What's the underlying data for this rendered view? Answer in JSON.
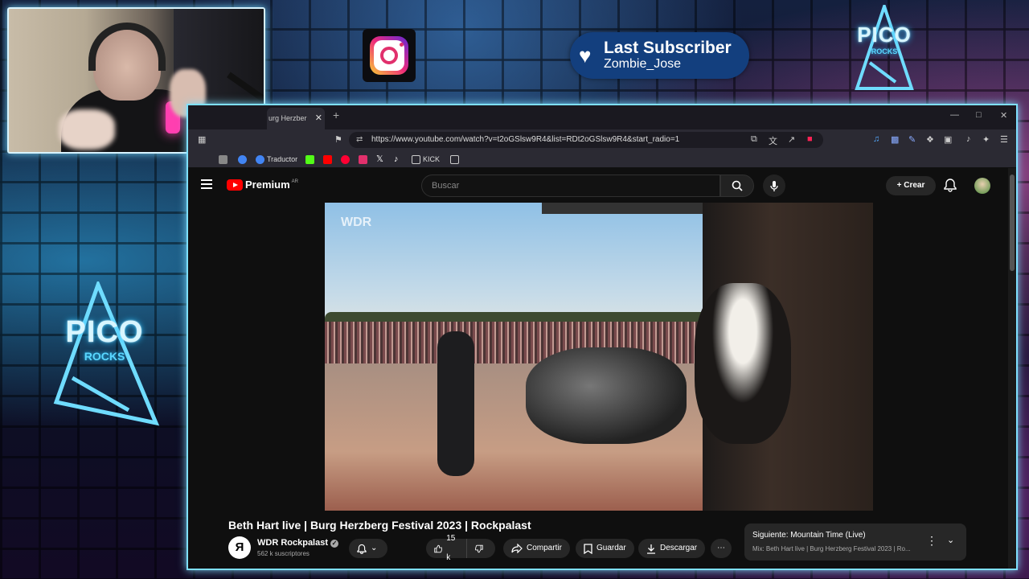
{
  "overlay": {
    "last_subscriber_title": "Last Subscriber",
    "last_subscriber_name": "Zombie_Jose",
    "logo_top_word": "PICO",
    "logo_top_sub": "ROCKS",
    "logo_side_word": "PICO",
    "logo_side_sub": "ROCKS",
    "accent_color": "#7fe0ff",
    "badge_color": "#133f7e",
    "icons": [
      "instagram-icon",
      "heart-icon"
    ]
  },
  "browser": {
    "tab_title": "urg Herzber",
    "url": "https://www.youtube.com/watch?v=t2oGSlsw9R4&list=RDt2oGSlsw9R4&start_radio=1",
    "bookmarks": [
      "Traductor",
      "KICK"
    ]
  },
  "youtube": {
    "logo_text": "Premium",
    "region": "AR",
    "search_placeholder": "Buscar",
    "create_label": "Crear",
    "video_watermark": "WDR",
    "video_title": "Beth Hart live | Burg Herzberg Festival 2023 | Rockpalast",
    "channel_name": "WDR Rockpalast",
    "subscribers": "562 k suscriptores",
    "like_count": "15 k",
    "share_label": "Compartir",
    "save_label": "Guardar",
    "download_label": "Descargar",
    "next_label": "Siguiente: Mountain Time (Live)",
    "mix_label": "Mix: Beth Hart live | Burg Herzberg Festival 2023 | Ro..."
  }
}
